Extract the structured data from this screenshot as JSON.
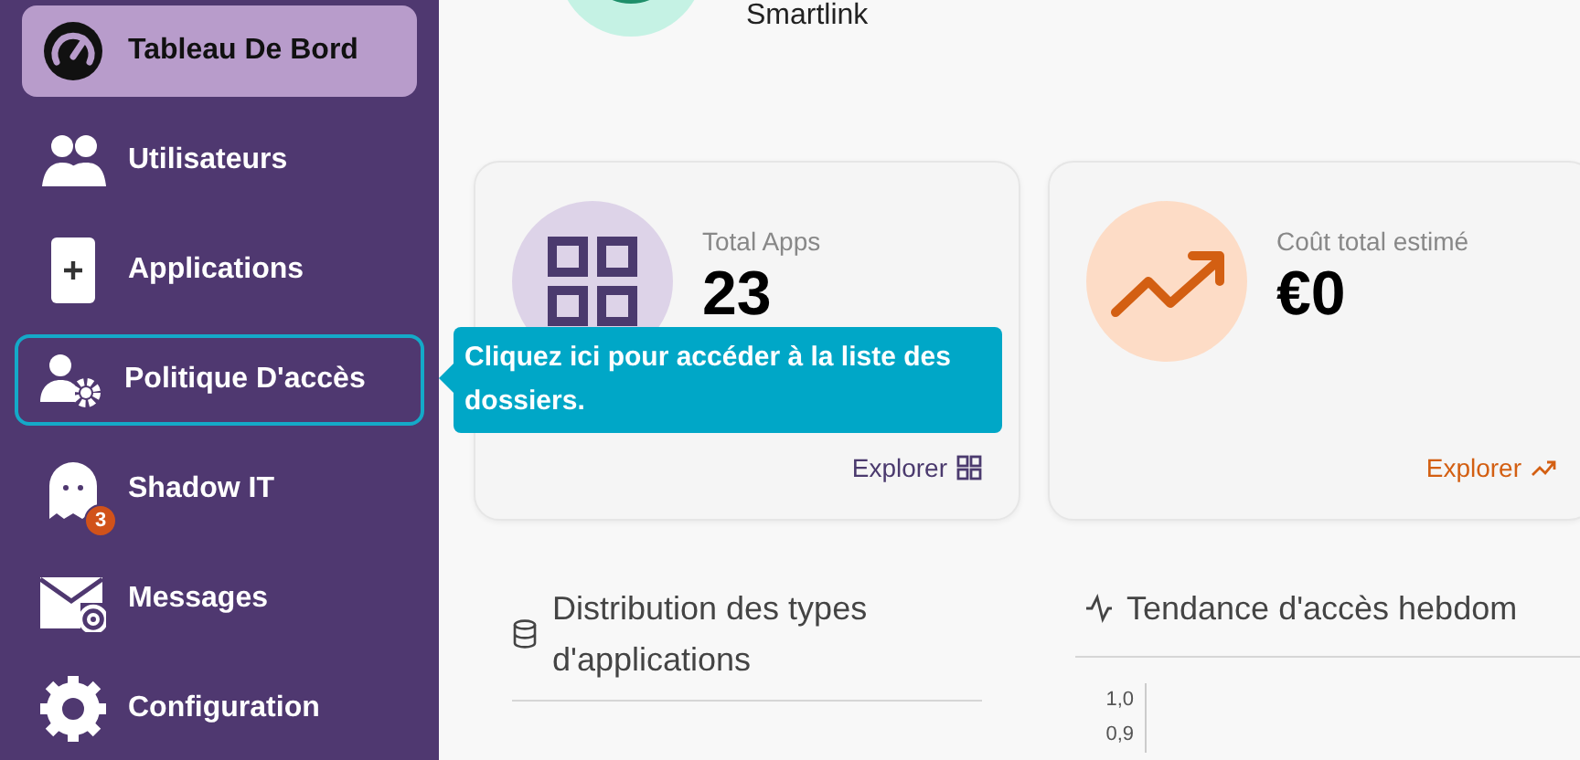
{
  "sidebar": {
    "items": [
      {
        "label": "Tableau De Bord",
        "selected": true,
        "focused": false
      },
      {
        "label": "Utilisateurs",
        "selected": false,
        "focused": false
      },
      {
        "label": "Applications",
        "selected": false,
        "focused": false
      },
      {
        "label": "Politique D'accès",
        "selected": false,
        "focused": true
      },
      {
        "label": "Shadow IT",
        "selected": false,
        "focused": false,
        "badge": "3"
      },
      {
        "label": "Messages",
        "selected": false,
        "focused": false
      },
      {
        "label": "Configuration",
        "selected": false,
        "focused": false
      }
    ]
  },
  "header": {
    "name": "Smartlink"
  },
  "stats": [
    {
      "kind": "apps",
      "label": "Total Apps",
      "value": "23",
      "link": "Explorer",
      "color": "#4b3a6e"
    },
    {
      "kind": "trend",
      "label": "Coût total estimé",
      "value": "€0",
      "link": "Explorer",
      "color": "#d35f12"
    }
  ],
  "tooltip": {
    "text": "Cliquez ici pour accéder à la liste des dossiers."
  },
  "panels": [
    {
      "kind": "database",
      "title": "Distribution des types d'applications"
    },
    {
      "kind": "activity",
      "title": "Tendance d'accès hebdom",
      "axis_labels": [
        "1,0",
        "0,9"
      ]
    }
  ]
}
